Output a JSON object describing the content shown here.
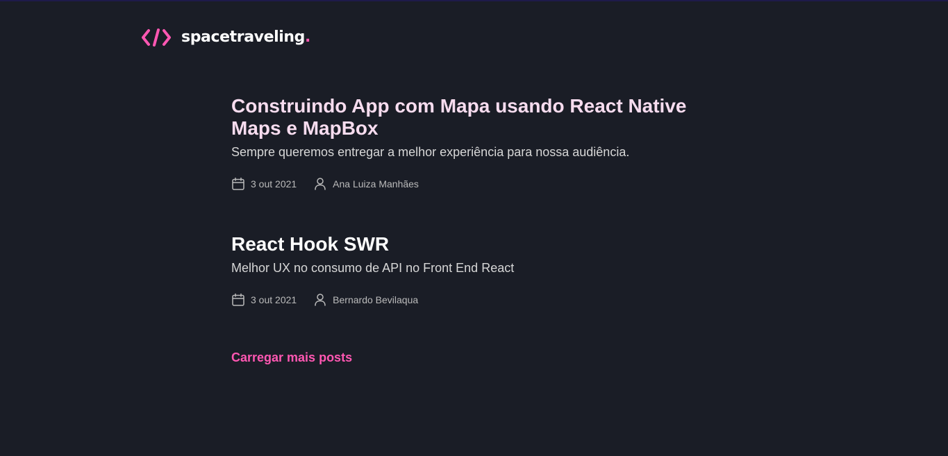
{
  "header": {
    "logo_icon": "code-brackets-icon",
    "logo_text": "spacetraveling",
    "logo_dot": ".",
    "accent_color": "#ff57b2"
  },
  "posts": [
    {
      "title": "Construindo App com Mapa usando React Native Maps e MapBox",
      "subtitle": "Sempre queremos entregar a melhor experiência para nossa audiência.",
      "date": "3 out 2021",
      "author": "Ana Luiza Manhães",
      "date_icon": "calendar-icon",
      "author_icon": "user-icon"
    },
    {
      "title": "React Hook SWR",
      "subtitle": "Melhor UX no consumo de API no Front End React",
      "date": "3 out 2021",
      "author": "Bernardo Bevilaqua",
      "date_icon": "calendar-icon",
      "author_icon": "user-icon"
    }
  ],
  "load_more": {
    "label": "Carregar mais posts"
  },
  "colors": {
    "background": "#1a1d26",
    "accent": "#ff57b2",
    "title": "#ffffff",
    "hovered_title": "#f7dcef",
    "subtitle": "#d7d7d7",
    "meta": "#bbbbbb"
  }
}
